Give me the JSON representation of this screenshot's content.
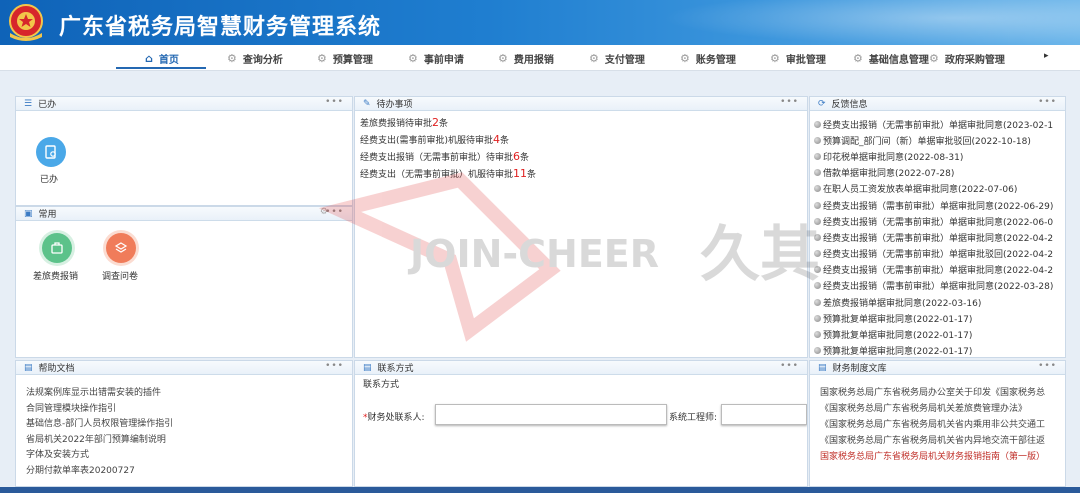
{
  "app": {
    "title": "广东省税务局智慧财务管理系统"
  },
  "nav": {
    "items": [
      {
        "label": "首页",
        "icon": "home-icon",
        "active": true
      },
      {
        "label": "查询分析",
        "icon": "gear-icon"
      },
      {
        "label": "预算管理",
        "icon": "gear-icon"
      },
      {
        "label": "事前申请",
        "icon": "gear-icon"
      },
      {
        "label": "费用报销",
        "icon": "gear-icon"
      },
      {
        "label": "支付管理",
        "icon": "gear-icon"
      },
      {
        "label": "账务管理",
        "icon": "gear-icon"
      },
      {
        "label": "审批管理",
        "icon": "gear-icon"
      },
      {
        "label": "基础信息管理",
        "icon": "gear-icon"
      },
      {
        "label": "政府采购管理",
        "icon": "gear-icon"
      }
    ],
    "more": "▸"
  },
  "panels": {
    "done": {
      "title": "已办",
      "item_label": "已办"
    },
    "common": {
      "title": "常用",
      "items": [
        {
          "label": "差旅费报销",
          "icon": "travel-icon",
          "color": "#5cc28a"
        },
        {
          "label": "调查问卷",
          "icon": "survey-icon",
          "color": "#f07c5a"
        }
      ]
    },
    "todo": {
      "title": "待办事项",
      "items": [
        {
          "text": "差旅费报销待审批",
          "count": "2",
          "suffix": "条"
        },
        {
          "text": "经费支出(需事前审批)机服待审批",
          "count": "4",
          "suffix": "条"
        },
        {
          "text": "经费支出报销（无需事前审批）待审批",
          "count": "6",
          "suffix": "条"
        },
        {
          "text": "经费支出（无需事前审批）机服待审批",
          "count": "11",
          "suffix": "条"
        }
      ]
    },
    "feedback": {
      "title": "反馈信息",
      "items": [
        "经费支出报销（无需事前审批）单据审批同意(2023-02-1",
        "预算调配_部门间（新）单据审批驳回(2022-10-18)",
        "印花税单据审批同意(2022-08-31)",
        "借款单据审批同意(2022-07-28)",
        "在职人员工资发放表单据审批同意(2022-07-06)",
        "经费支出报销（需事前审批）单据审批同意(2022-06-29)",
        "经费支出报销（无需事前审批）单据审批同意(2022-06-0",
        "经费支出报销（无需事前审批）单据审批同意(2022-04-2",
        "经费支出报销（无需事前审批）单据审批驳回(2022-04-2",
        "经费支出报销（无需事前审批）单据审批同意(2022-04-2",
        "经费支出报销（需事前审批）单据审批同意(2022-03-28)",
        "差旅费报销单据审批同意(2022-03-16)",
        "预算批复单据审批同意(2022-01-17)",
        "预算批复单据审批同意(2022-01-17)",
        "预算批复单据审批同意(2022-01-17)"
      ]
    },
    "help": {
      "title": "帮助文档",
      "items": [
        "法规案例库显示出错需安装的插件",
        "合同管理模块操作指引",
        "基础信息-部门人员权限管理操作指引",
        "省局机关2022年部门预算编制说明",
        "字体及安装方式",
        "分期付款单率表20200727"
      ]
    },
    "contact": {
      "title": "联系方式",
      "heading": "联系方式",
      "finance_label": "财务处联系人:",
      "engineer_label": "系统工程师:",
      "finance_value": "",
      "engineer_value": ""
    },
    "library": {
      "title": "财务制度文库",
      "items": [
        {
          "text": "国家税务总局广东省税务局办公室关于印发《国家税务总",
          "red": false
        },
        {
          "text": "《国家税务总局广东省税务局机关差旅费管理办法》",
          "red": false
        },
        {
          "text": "《国家税务总局广东省税务局机关省内乘用非公共交通工",
          "red": false
        },
        {
          "text": "《国家税务总局广东省税务局机关省内异地交流干部往返",
          "red": false
        },
        {
          "text": "国家税务总局广东省税务局机关财务报销指南（第一版）",
          "red": true
        }
      ]
    }
  },
  "watermark": {
    "text": "JOIN-CHEER",
    "cn": "久其"
  },
  "colors": {
    "header": "#1f7ed0",
    "accent": "#2468b2",
    "count_red": "#e02020",
    "panel_border": "#cbd9e8"
  }
}
